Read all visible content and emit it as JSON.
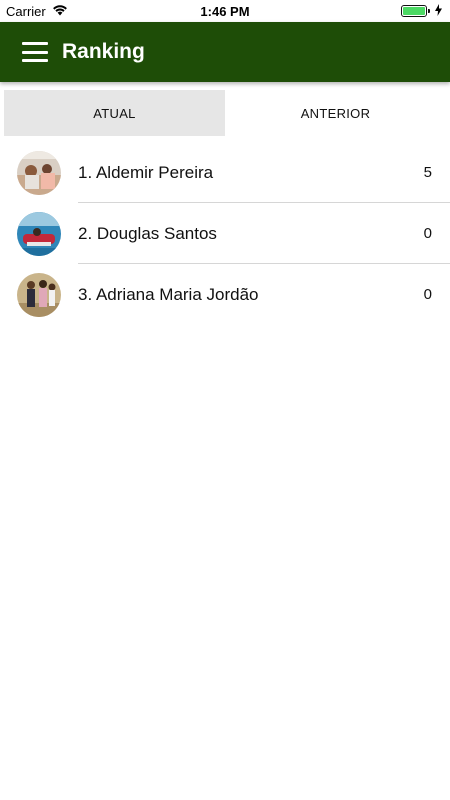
{
  "status_bar": {
    "carrier": "Carrier",
    "time": "1:46 PM",
    "wifi_icon": "wifi-icon",
    "battery_icon": "battery-icon",
    "charging_icon": "bolt-icon"
  },
  "app_bar": {
    "title": "Ranking",
    "menu_icon": "hamburger-menu-icon",
    "background": "#1e4d07"
  },
  "tabs": [
    {
      "label": "ATUAL",
      "active": true
    },
    {
      "label": "ANTERIOR",
      "active": false
    }
  ],
  "ranking": [
    {
      "name": "1. Aldemir Pereira",
      "score": "5"
    },
    {
      "name": "2. Douglas Santos",
      "score": "0"
    },
    {
      "name": "3. Adriana Maria Jordão",
      "score": "0"
    }
  ]
}
